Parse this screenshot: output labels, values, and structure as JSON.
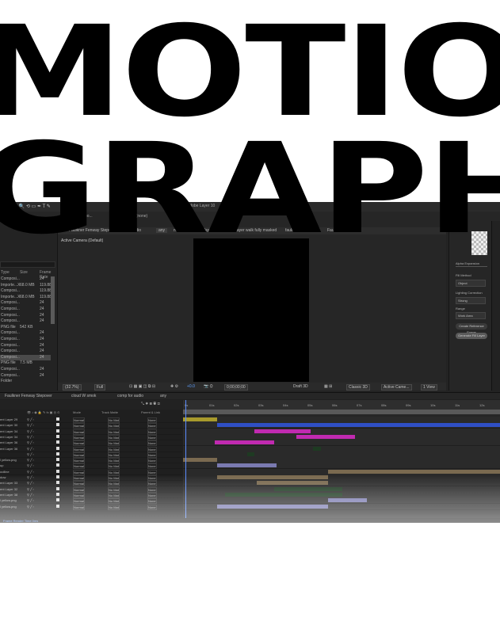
{
  "app": {
    "toolbar_items": [
      "Footage (none)",
      "Adobe Layer 10"
    ],
    "panel_tabs": {
      "footage": "Footage (none)"
    },
    "project": {
      "columns": {
        "type": "Type",
        "size": "Size",
        "frame_rate": "Frame Rate"
      },
      "items": [
        {
          "type": "Composi...",
          "size": "",
          "rate": "24"
        },
        {
          "type": "Importe...X",
          "size": "68.0 MB",
          "rate": "119.88"
        },
        {
          "type": "Composi...",
          "size": "",
          "rate": "119.88"
        },
        {
          "type": "Importe...X",
          "size": "68.0 MB",
          "rate": "119.88"
        },
        {
          "type": "Composi...",
          "size": "",
          "rate": "24"
        },
        {
          "type": "Composi...",
          "size": "",
          "rate": "24"
        },
        {
          "type": "Composi...",
          "size": "",
          "rate": "24"
        },
        {
          "type": "Composi...",
          "size": "",
          "rate": "24"
        },
        {
          "type": "PNG file",
          "size": "542 KB",
          "rate": ""
        },
        {
          "type": "Composi...",
          "size": "",
          "rate": "24"
        },
        {
          "type": "Composi...",
          "size": "",
          "rate": "24"
        },
        {
          "type": "Composi...",
          "size": "",
          "rate": "24"
        },
        {
          "type": "Composi...",
          "size": "",
          "rate": "24"
        },
        {
          "type": "Composi...",
          "size": "",
          "rate": "24"
        },
        {
          "type": "PNG file",
          "size": "7.5 MB",
          "rate": ""
        },
        {
          "type": "Composi...",
          "size": "",
          "rate": "24"
        },
        {
          "type": "Composi...",
          "size": "",
          "rate": "24"
        },
        {
          "type": "Folder",
          "size": "",
          "rate": ""
        }
      ]
    },
    "viewer": {
      "tabs": [
        "Faulkner Fenway Stepover",
        "comp for audio",
        "any",
        "moving up",
        "player shadow",
        "player walk fully masked",
        "faulkner walk final",
        "Faulkner walk"
      ],
      "active_tab": "any",
      "camera_label": "Active Camera (Default)",
      "zoom": "(32.7%)",
      "resolution": "Full",
      "exposure": "+0.0",
      "timecode": "0;00;00;00",
      "renderer": "Draft 3D",
      "renderer_mode": "Classic 3D",
      "view_camera": "Active Came...",
      "view_layout": "1 View"
    },
    "right_panel": {
      "alpha_expansion": "Alpha Expansion",
      "fill_method_label": "Fill Method",
      "fill_method": "Object",
      "lighting_label": "Lighting Correction",
      "lighting_value": "Strong",
      "range_label": "Range",
      "range_value": "Work Area",
      "create_ref": "Create Reference Frame",
      "generate": "Generate Fill Layer"
    },
    "timeline": {
      "tabs": [
        "Faulkner Fenway Stepover",
        "cloud W smok",
        "comp for audio",
        "any"
      ],
      "columns": {
        "mode": "Mode",
        "track_matte": "Track Matte",
        "parent": "Parent & Link"
      },
      "layers": [
        {
          "name": "ent Layer 29",
          "mode": "Normal",
          "matte": "No Mat",
          "parent": "None"
        },
        {
          "name": "ent Layer 30",
          "mode": "Normal",
          "matte": "No Mat",
          "parent": "None"
        },
        {
          "name": "ent Layer 34",
          "mode": "Normal",
          "matte": "No Mat",
          "parent": "None"
        },
        {
          "name": "ent Layer 34",
          "mode": "Normal",
          "matte": "No Mat",
          "parent": "None"
        },
        {
          "name": "ent Layer 36",
          "mode": "Normal",
          "matte": "No Mat",
          "parent": "None"
        },
        {
          "name": "ent Layer 36",
          "mode": "Normal",
          "matte": "No Mat",
          "parent": "None"
        },
        {
          "name": "",
          "mode": "Normal",
          "matte": "No Mat",
          "parent": "None"
        },
        {
          "name": "l yellow.png",
          "mode": "Normal",
          "matte": "No Mat",
          "parent": "None"
        },
        {
          "name": "up",
          "mode": "Normal",
          "matte": "No Mat",
          "parent": "None"
        },
        {
          "name": "oolline",
          "mode": "Normal",
          "matte": "No Mat",
          "parent": "None"
        },
        {
          "name": "dow",
          "mode": "Normal",
          "matte": "No Mat",
          "parent": "None"
        },
        {
          "name": "ent Layer 33",
          "mode": "Normal",
          "matte": "No Mat",
          "parent": "None"
        },
        {
          "name": "ent Layer 32",
          "mode": "Normal",
          "matte": "No Mat",
          "parent": "None"
        },
        {
          "name": "ent Layer 38",
          "mode": "Normal",
          "matte": "No Mat",
          "parent": "None"
        },
        {
          "name": "l yellow.png",
          "mode": "Normal",
          "matte": "No Mat",
          "parent": "None"
        },
        {
          "name": "l yellow.png",
          "mode": "Normal",
          "matte": "No Mat",
          "parent": "None"
        }
      ],
      "ruler_ticks": [
        "0s",
        "01s",
        "02s",
        "03s",
        "04s",
        "05s",
        "06s",
        "07s",
        "08s",
        "09s",
        "10s",
        "11s",
        "12s"
      ],
      "status": "Frame Render Time 0ms"
    }
  },
  "headline": {
    "line1": "MOTION",
    "line2": "GRAPHICS"
  },
  "colors": {
    "headline": "#000000",
    "background": "#ffffff",
    "panel": "#232323",
    "bar_yellow": "#a89a2c",
    "bar_blue": "#2f4fc4",
    "bar_magenta": "#c02ab0",
    "bar_tan": "#7a6a50",
    "bar_dark_green": "#1e3a22",
    "bar_lavender": "#7a7ab0"
  }
}
